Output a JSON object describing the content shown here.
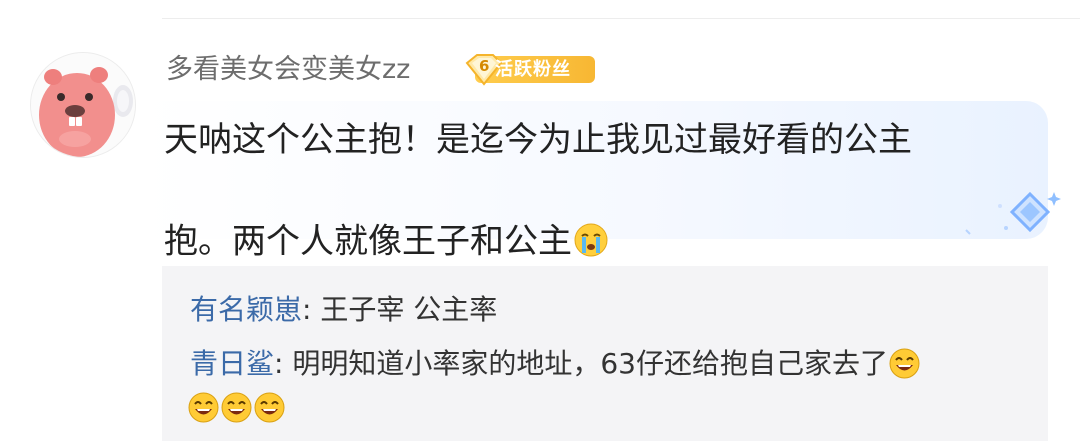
{
  "comment": {
    "username": "多看美女会变美女zz",
    "badge": {
      "level": "6",
      "label": "活跃粉丝",
      "color": "#f7b733"
    },
    "text": "天呐这个公主抱！是迄今为止我见过最好看的公主\n抱。两个人就像王子和公主",
    "trailing_emoji": "crying-emoji"
  },
  "replies": [
    {
      "name": "有名颖崽",
      "separator": ":",
      "text": " 王子宰 公主率"
    },
    {
      "name": "青日鲨",
      "separator": ":",
      "text": " 明明知道小率家的地址，63仔还给抱自己家去了",
      "emojis": [
        "laughing-emoji",
        "laughing-emoji",
        "laughing-emoji",
        "laughing-emoji"
      ]
    }
  ],
  "colors": {
    "reply_name": "#3b6aa8",
    "username": "#6d6d6d",
    "reply_bg": "#f4f4f6"
  }
}
